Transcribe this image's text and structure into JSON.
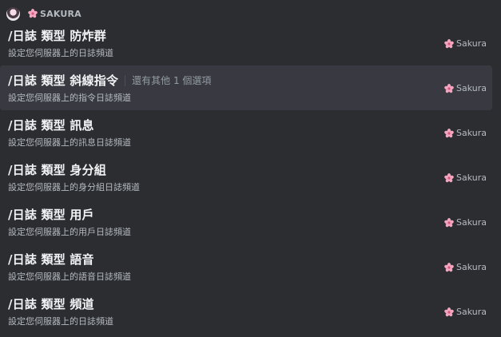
{
  "header": {
    "bot_name": "SAKURA",
    "avatar_icon": "bot-avatar",
    "name_icon": "sakura-flower-icon"
  },
  "colors": {
    "background": "#2b2d31",
    "selected_row": "#393a41",
    "title_text": "#f2f3f5",
    "muted_text": "#b5bac1",
    "flower_pink": "#f3a6c0"
  },
  "commands": [
    {
      "name": "/日誌 類型 防炸群",
      "description": "設定您伺服器上的日誌頻道",
      "source": "Sakura",
      "selected": false,
      "more_options": ""
    },
    {
      "name": "/日誌 類型 斜線指令",
      "description": "設定您伺服器上的指令日誌頻道",
      "source": "Sakura",
      "selected": true,
      "more_options": "還有其他 1 個選項"
    },
    {
      "name": "/日誌 類型 訊息",
      "description": "設定您伺服器上的訊息日誌頻道",
      "source": "Sakura",
      "selected": false,
      "more_options": ""
    },
    {
      "name": "/日誌 類型 身分組",
      "description": "設定您伺服器上的身分組日誌頻道",
      "source": "Sakura",
      "selected": false,
      "more_options": ""
    },
    {
      "name": "/日誌 類型 用戶",
      "description": "設定您伺服器上的用戶日誌頻道",
      "source": "Sakura",
      "selected": false,
      "more_options": ""
    },
    {
      "name": "/日誌 類型 語音",
      "description": "設定您伺服器上的語音日誌頻道",
      "source": "Sakura",
      "selected": false,
      "more_options": ""
    },
    {
      "name": "/日誌 類型 頻道",
      "description": "設定您伺服器上的日誌頻道",
      "source": "Sakura",
      "selected": false,
      "more_options": ""
    }
  ]
}
